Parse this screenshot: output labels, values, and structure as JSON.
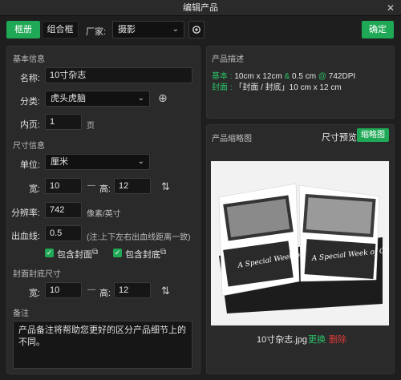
{
  "window": {
    "title": "编辑产品",
    "close": "✕"
  },
  "toolbar": {
    "tab_layout": "框册",
    "tab_combo": "组合框",
    "vendor_label": "厂家:",
    "vendor_value": "摄影",
    "confirm": "确定"
  },
  "basic": {
    "title": "基本信息",
    "name_label": "名称:",
    "name_value": "10寸杂志",
    "category_label": "分类:",
    "category_value": "虎头虎脑",
    "pages_label": "内页:",
    "pages_value": "1",
    "pages_unit": "页"
  },
  "size": {
    "title": "尺寸信息",
    "unit_label": "单位:",
    "unit_value": "厘米",
    "width_label": "宽:",
    "width_value": "10",
    "height_label": "高:",
    "height_value": "12",
    "dash": "—",
    "dpi_label": "分辨率:",
    "dpi_value": "742",
    "dpi_unit": "像素/英寸",
    "bleed_label": "出血线:",
    "bleed_value": "0.5",
    "bleed_note": "(注:上下左右出血线距离一致)",
    "include_cover": "包含封面",
    "include_back": "包含封底"
  },
  "cover": {
    "title": "封面封底尺寸",
    "width_label": "宽:",
    "width_value": "10",
    "height_label": "高:",
    "height_value": "12",
    "dash": "—"
  },
  "notes": {
    "title": "备注",
    "text": "产品备注将帮助您更好的区分产品细节上的不同。"
  },
  "description": {
    "title": "产品描述",
    "line1_prefix": "基本 :",
    "line1_size": "10cm x 12cm",
    "line1_amp": "&",
    "line1_bleed": "0.5 cm",
    "line1_at": "@",
    "line1_dpi": "742DPI",
    "line2_prefix": "封面 :",
    "line2_text": "「封面 / 封底」10 cm x 12 cm"
  },
  "thumbnail": {
    "title": "产品缩略图",
    "size_preview": "尺寸预览",
    "thumb_btn": "缩略图",
    "filename": "10寸杂志.jpg",
    "replace": "更换",
    "delete": "删除",
    "photo_text_left": "A Special Week of Content",
    "photo_text_right": "A Special Week of Content"
  },
  "colors": {
    "accent": "#1fa855",
    "danger": "#e03a3a",
    "bg": "#1e1e1e",
    "panel": "#2a2a2a"
  }
}
